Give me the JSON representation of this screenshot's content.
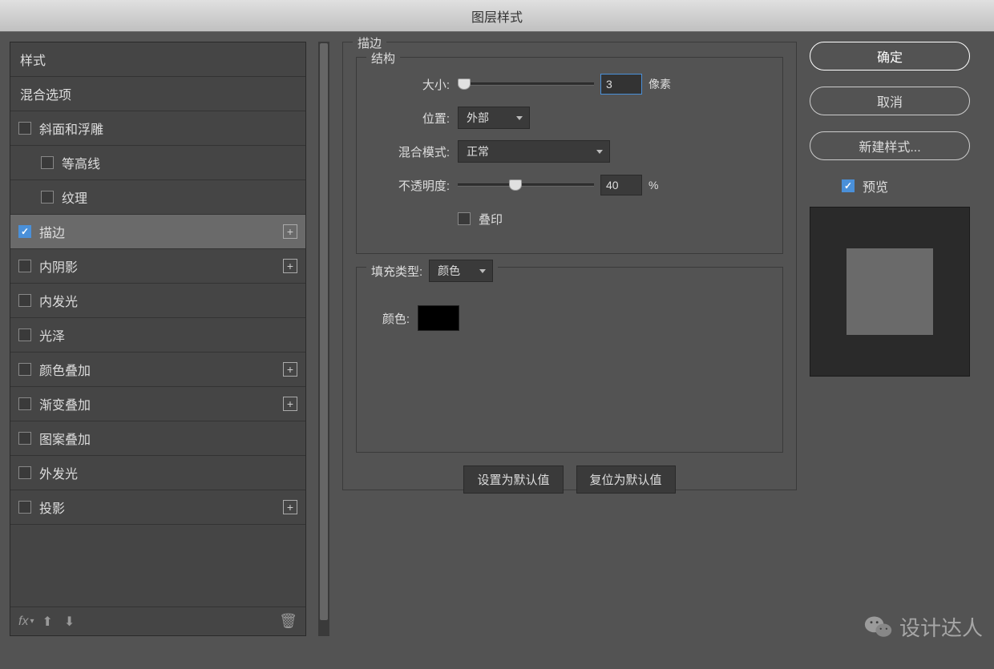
{
  "window": {
    "title": "图层样式"
  },
  "sidebar": {
    "header": "样式",
    "blend_options": "混合选项",
    "items": [
      {
        "label": "斜面和浮雕",
        "checked": false,
        "has_plus": false,
        "indent": 0
      },
      {
        "label": "等高线",
        "checked": false,
        "has_plus": false,
        "indent": 1
      },
      {
        "label": "纹理",
        "checked": false,
        "has_plus": false,
        "indent": 1
      },
      {
        "label": "描边",
        "checked": true,
        "has_plus": true,
        "indent": 0,
        "selected": true
      },
      {
        "label": "内阴影",
        "checked": false,
        "has_plus": true,
        "indent": 0
      },
      {
        "label": "内发光",
        "checked": false,
        "has_plus": false,
        "indent": 0
      },
      {
        "label": "光泽",
        "checked": false,
        "has_plus": false,
        "indent": 0
      },
      {
        "label": "颜色叠加",
        "checked": false,
        "has_plus": true,
        "indent": 0
      },
      {
        "label": "渐变叠加",
        "checked": false,
        "has_plus": true,
        "indent": 0
      },
      {
        "label": "图案叠加",
        "checked": false,
        "has_plus": false,
        "indent": 0
      },
      {
        "label": "外发光",
        "checked": false,
        "has_plus": false,
        "indent": 0
      },
      {
        "label": "投影",
        "checked": false,
        "has_plus": true,
        "indent": 0
      }
    ],
    "fx": "fx"
  },
  "stroke": {
    "panel_title": "描边",
    "structure_title": "结构",
    "size_label": "大小:",
    "size_value": "3",
    "size_unit": "像素",
    "position_label": "位置:",
    "position_value": "外部",
    "blend_label": "混合模式:",
    "blend_value": "正常",
    "opacity_label": "不透明度:",
    "opacity_value": "40",
    "opacity_unit": "%",
    "overprint_label": "叠印",
    "fill_type_label": "填充类型:",
    "fill_type_value": "颜色",
    "color_label": "颜色:",
    "color_value": "#000000",
    "set_default": "设置为默认值",
    "reset_default": "复位为默认值"
  },
  "right": {
    "ok": "确定",
    "cancel": "取消",
    "new_style": "新建样式...",
    "preview_label": "预览"
  },
  "watermark": {
    "text": "设计达人"
  }
}
